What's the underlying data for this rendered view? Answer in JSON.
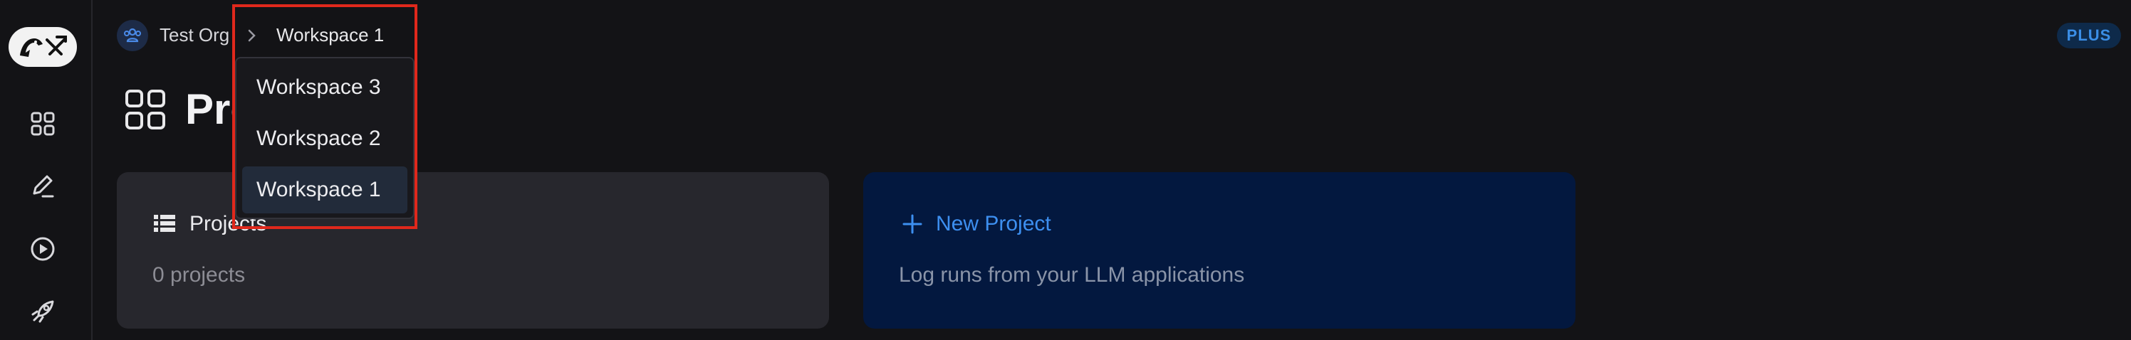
{
  "header": {
    "org_name": "Test Org",
    "workspace": "Workspace 1",
    "plan_badge": "PLUS"
  },
  "page": {
    "title": "Projects"
  },
  "cards": {
    "projects": {
      "title": "Projects",
      "subtitle": "0 projects"
    },
    "new_project": {
      "title": "New Project",
      "subtitle": "Log runs from your LLM applications"
    }
  },
  "workspace_dropdown": {
    "items": [
      {
        "label": "Workspace 3"
      },
      {
        "label": "Workspace 2"
      },
      {
        "label": "Workspace 1",
        "selected": true
      }
    ]
  },
  "sidebar": {
    "icons": [
      "grid-icon",
      "pencil-icon",
      "play-circle-icon",
      "rocket-icon"
    ]
  },
  "colors": {
    "background": "#131316",
    "accent": "#3d8ff0",
    "highlight": "#e0281c"
  }
}
